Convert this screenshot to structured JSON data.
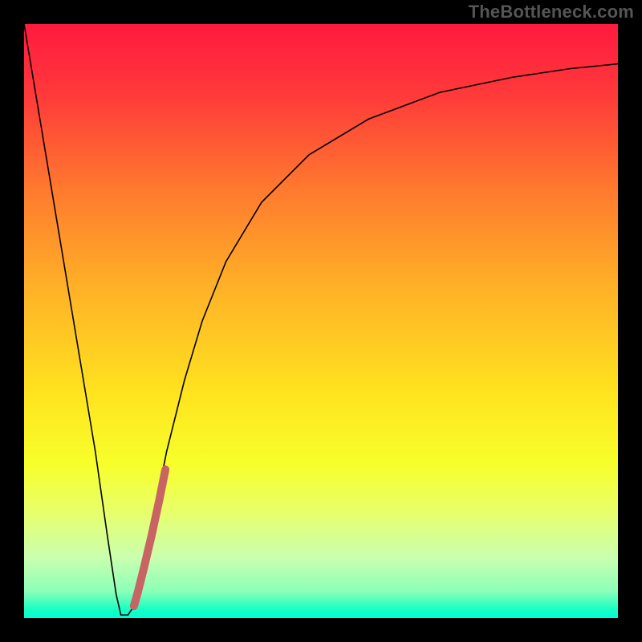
{
  "watermark": "TheBottleneck.com",
  "chart_data": {
    "type": "line",
    "title": "",
    "xlabel": "",
    "ylabel": "",
    "xlim": [
      0,
      100
    ],
    "ylim": [
      0,
      100
    ],
    "background_gradient": {
      "stops": [
        {
          "offset": 0.0,
          "color": "#ff1a3f"
        },
        {
          "offset": 0.12,
          "color": "#ff3a3a"
        },
        {
          "offset": 0.28,
          "color": "#ff7a2e"
        },
        {
          "offset": 0.45,
          "color": "#ffb327"
        },
        {
          "offset": 0.62,
          "color": "#ffe31f"
        },
        {
          "offset": 0.74,
          "color": "#f7ff2a"
        },
        {
          "offset": 0.82,
          "color": "#e9ff6a"
        },
        {
          "offset": 0.9,
          "color": "#c8ffb0"
        },
        {
          "offset": 0.955,
          "color": "#8cffb8"
        },
        {
          "offset": 0.985,
          "color": "#1affc3"
        },
        {
          "offset": 1.0,
          "color": "#00ffd5"
        }
      ]
    },
    "series": [
      {
        "name": "bottleneck-curve",
        "stroke": "#000000",
        "stroke_width": 1.6,
        "points": [
          {
            "x": 0.0,
            "y": 100.0
          },
          {
            "x": 3.0,
            "y": 82.0
          },
          {
            "x": 6.0,
            "y": 64.0
          },
          {
            "x": 9.0,
            "y": 46.0
          },
          {
            "x": 12.0,
            "y": 28.0
          },
          {
            "x": 14.0,
            "y": 14.0
          },
          {
            "x": 15.5,
            "y": 4.0
          },
          {
            "x": 16.3,
            "y": 0.5
          },
          {
            "x": 17.5,
            "y": 0.5
          },
          {
            "x": 18.5,
            "y": 2.0
          },
          {
            "x": 20.0,
            "y": 8.0
          },
          {
            "x": 22.0,
            "y": 18.0
          },
          {
            "x": 24.0,
            "y": 28.0
          },
          {
            "x": 27.0,
            "y": 40.0
          },
          {
            "x": 30.0,
            "y": 50.0
          },
          {
            "x": 34.0,
            "y": 60.0
          },
          {
            "x": 40.0,
            "y": 70.0
          },
          {
            "x": 48.0,
            "y": 78.0
          },
          {
            "x": 58.0,
            "y": 84.0
          },
          {
            "x": 70.0,
            "y": 88.5
          },
          {
            "x": 82.0,
            "y": 91.0
          },
          {
            "x": 92.0,
            "y": 92.5
          },
          {
            "x": 100.0,
            "y": 93.3
          }
        ]
      },
      {
        "name": "highlight-segment",
        "stroke": "#c86464",
        "stroke_width": 10,
        "linecap": "round",
        "points": [
          {
            "x": 18.5,
            "y": 2.0
          },
          {
            "x": 19.2,
            "y": 4.5
          },
          {
            "x": 20.2,
            "y": 8.5
          },
          {
            "x": 21.5,
            "y": 14.0
          },
          {
            "x": 22.8,
            "y": 20.0
          },
          {
            "x": 23.8,
            "y": 25.0
          }
        ]
      }
    ]
  }
}
